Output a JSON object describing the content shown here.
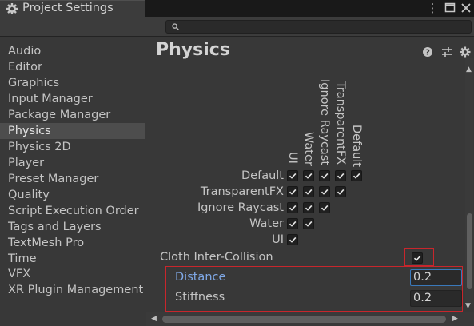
{
  "window": {
    "tab_title": "Project Settings",
    "tab_icon": "gear-icon",
    "controls": [
      "more-vert-icon",
      "maximize-icon",
      "close-icon"
    ]
  },
  "search": {
    "placeholder": "",
    "value": ""
  },
  "sidebar": {
    "items": [
      {
        "label": "Audio"
      },
      {
        "label": "Editor"
      },
      {
        "label": "Graphics"
      },
      {
        "label": "Input Manager"
      },
      {
        "label": "Package Manager"
      },
      {
        "label": "Physics",
        "selected": true
      },
      {
        "label": "Physics 2D"
      },
      {
        "label": "Player"
      },
      {
        "label": "Preset Manager"
      },
      {
        "label": "Quality"
      },
      {
        "label": "Script Execution Order"
      },
      {
        "label": "Tags and Layers"
      },
      {
        "label": "TextMesh Pro"
      },
      {
        "label": "Time"
      },
      {
        "label": "VFX"
      },
      {
        "label": "XR Plugin Management"
      }
    ]
  },
  "main": {
    "title": "Physics",
    "header_icons": [
      "help-icon",
      "preset-icon",
      "settings-icon"
    ],
    "matrix": {
      "columns": [
        "UI",
        "Water",
        "Ignore Raycast",
        "TransparentFX",
        "Default"
      ],
      "rows": [
        "Default",
        "TransparentFX",
        "Ignore Raycast",
        "Water",
        "UI"
      ],
      "all_checked": true
    },
    "cloth_inter_collision": {
      "label": "Cloth Inter-Collision",
      "checked": true
    },
    "distance": {
      "label": "Distance",
      "value": "0.2"
    },
    "stiffness": {
      "label": "Stiffness",
      "value": "0.2"
    }
  },
  "colors": {
    "highlight_red": "#c8262c",
    "focus_blue": "#3a79bb",
    "label_blue": "#7fa8e6"
  }
}
